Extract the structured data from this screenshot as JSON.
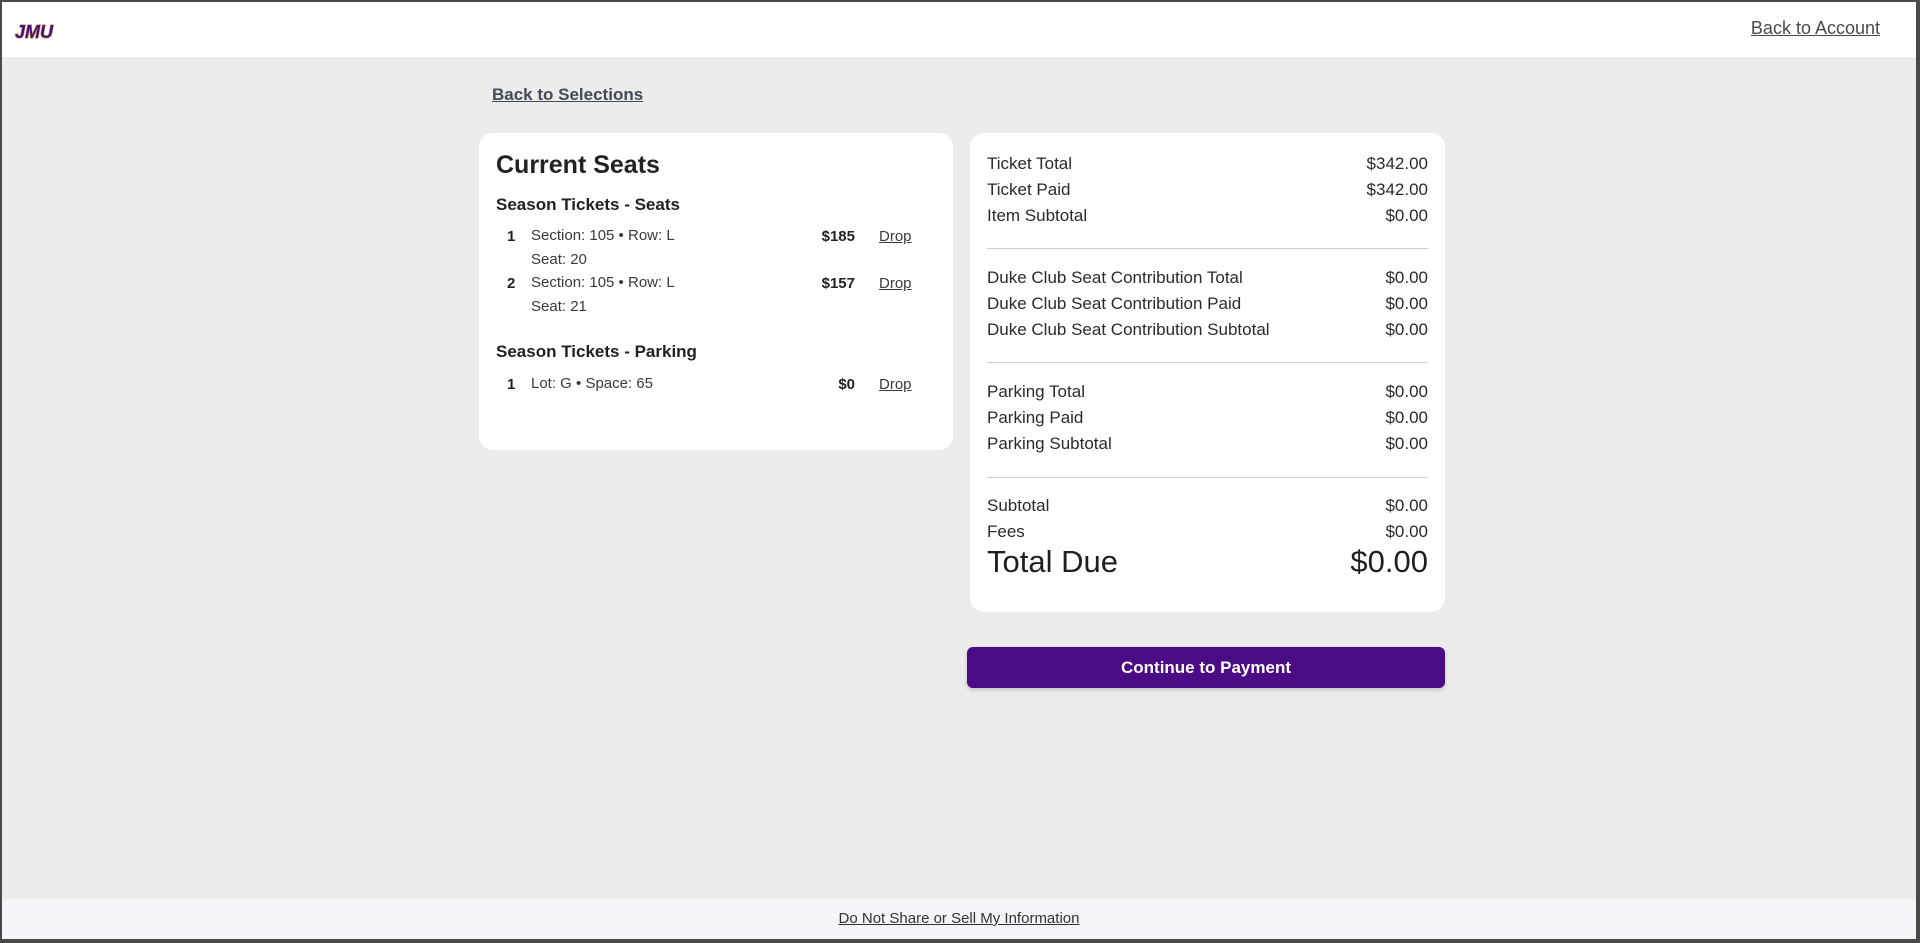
{
  "header": {
    "logo_text": "JMU",
    "back_to_account": "Back to Account"
  },
  "nav": {
    "back_to_selections": "Back to Selections"
  },
  "current_seats": {
    "title": "Current Seats",
    "seat_group": {
      "title": "Season Tickets - Seats",
      "items": [
        {
          "num": "1",
          "line1": "Section: 105 • Row: L",
          "line2": "Seat: 20",
          "price": "$185",
          "drop": "Drop"
        },
        {
          "num": "2",
          "line1": "Section: 105 • Row: L",
          "line2": "Seat: 21",
          "price": "$157",
          "drop": "Drop"
        }
      ]
    },
    "parking_group": {
      "title": "Season Tickets - Parking",
      "items": [
        {
          "num": "1",
          "line1": "Lot: G • Space: 65",
          "price": "$0",
          "drop": "Drop"
        }
      ]
    }
  },
  "summary": {
    "ticket": [
      {
        "label": "Ticket Total",
        "value": "$342.00"
      },
      {
        "label": "Ticket Paid",
        "value": "$342.00"
      },
      {
        "label": "Item Subtotal",
        "value": "$0.00"
      }
    ],
    "contribution": [
      {
        "label": "Duke Club Seat Contribution Total",
        "value": "$0.00"
      },
      {
        "label": "Duke Club Seat Contribution Paid",
        "value": "$0.00"
      },
      {
        "label": "Duke Club Seat Contribution Subtotal",
        "value": "$0.00"
      }
    ],
    "parking": [
      {
        "label": "Parking Total",
        "value": "$0.00"
      },
      {
        "label": "Parking Paid",
        "value": "$0.00"
      },
      {
        "label": "Parking Subtotal",
        "value": "$0.00"
      }
    ],
    "totals": [
      {
        "label": "Subtotal",
        "value": "$0.00"
      },
      {
        "label": "Fees",
        "value": "$0.00"
      }
    ],
    "total_due": {
      "label": "Total Due",
      "value": "$0.00"
    }
  },
  "actions": {
    "continue_label": "Continue to Payment"
  },
  "footer": {
    "privacy_link": "Do Not Share or Sell My Information"
  },
  "colors": {
    "brand_purple": "#4b0b85",
    "logo_gold": "#c8a94b",
    "page_bg": "#ececec"
  }
}
